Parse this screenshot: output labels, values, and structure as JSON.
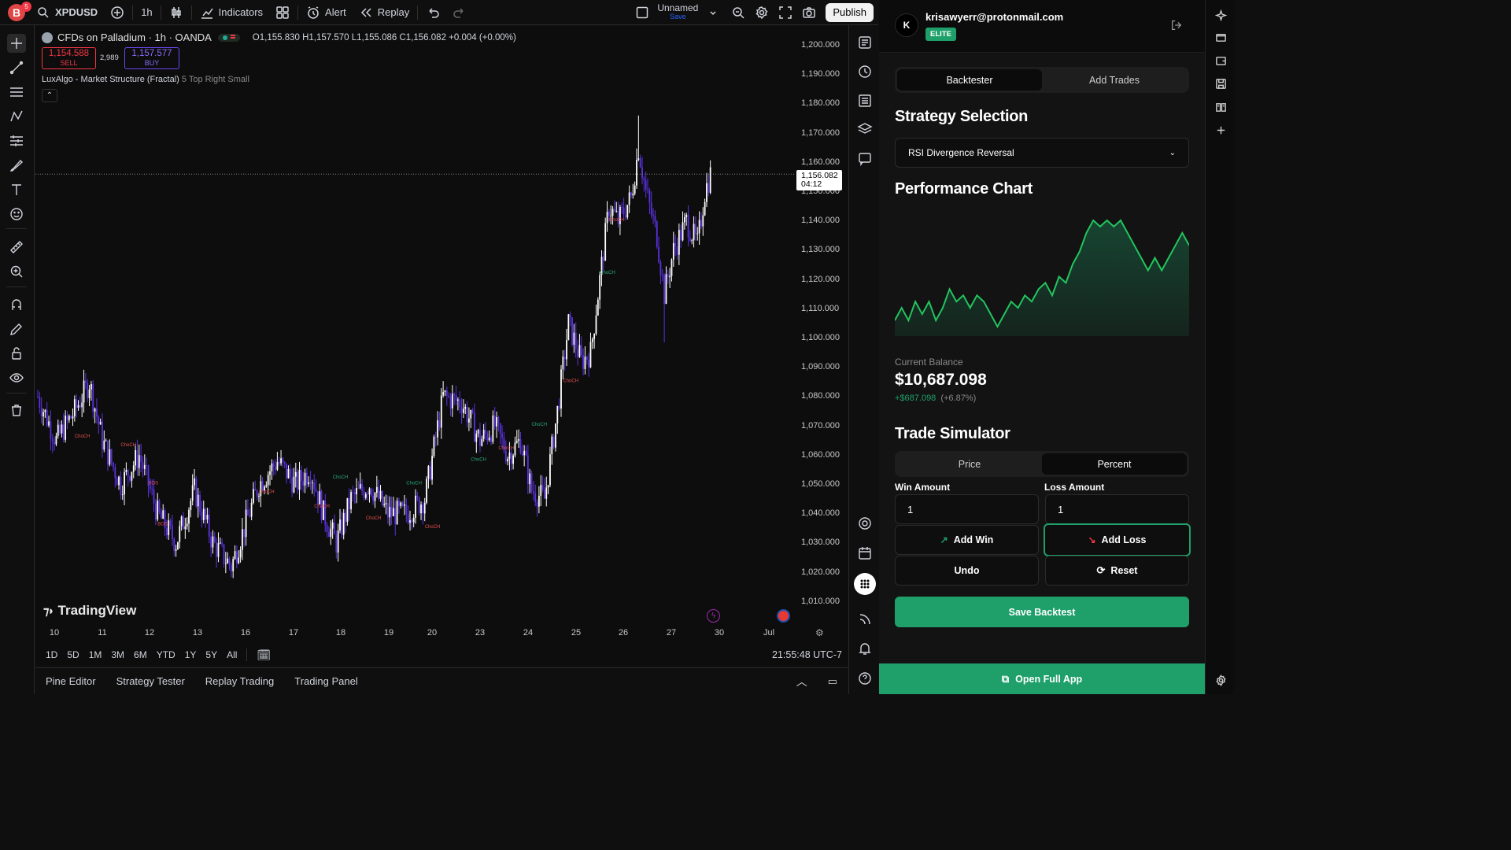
{
  "topbar": {
    "avatar_letter": "B",
    "avatar_badge": "5",
    "symbol": "XPDUSD",
    "interval": "1h",
    "indicators_label": "Indicators",
    "alert_label": "Alert",
    "replay_label": "Replay",
    "layout_name": "Unnamed",
    "layout_save": "Save",
    "publish_label": "Publish"
  },
  "legend": {
    "title": "CFDs on Palladium · 1h · OANDA",
    "ohlc": "O1,155.830 H1,157.570 L1,155.086 C1,156.082 +0.004 (+0.00%)",
    "sell_price": "1,154.588",
    "sell_label": "SELL",
    "spread": "2,989",
    "buy_price": "1,157.577",
    "buy_label": "BUY",
    "indicator_name": "LuxAlgo - Market Structure (Fractal)",
    "indicator_params": "5 Top Right Small",
    "collapse_glyph": "⌃"
  },
  "price_axis": {
    "ticks": [
      "1,200.000",
      "1,190.000",
      "1,180.000",
      "1,170.000",
      "1,160.000",
      "1,150.000",
      "1,140.000",
      "1,130.000",
      "1,120.000",
      "1,110.000",
      "1,100.000",
      "1,090.000",
      "1,080.000",
      "1,070.000",
      "1,060.000",
      "1,050.000",
      "1,040.000",
      "1,030.000",
      "1,020.000",
      "1,010.000"
    ],
    "last_price": "1,156.082",
    "countdown": "04:12"
  },
  "time_axis": {
    "ticks": [
      "10",
      "11",
      "12",
      "13",
      "16",
      "17",
      "18",
      "19",
      "20",
      "23",
      "24",
      "25",
      "26",
      "27",
      "30",
      "Jul"
    ]
  },
  "chart_data": {
    "type": "candlestick",
    "symbol": "XPDUSD",
    "ylim": [
      1010,
      1200
    ],
    "current_price": 1156.082,
    "structure_labels": [
      {
        "text": "ChoCH",
        "color": "red"
      },
      {
        "text": "BOS",
        "color": "red"
      },
      {
        "text": "ChoCH",
        "color": "green"
      },
      {
        "text": "BOS",
        "color": "green"
      }
    ]
  },
  "watermark": "TradingView",
  "range_buttons": [
    "1D",
    "5D",
    "1M",
    "3M",
    "6M",
    "YTD",
    "1Y",
    "5Y",
    "All"
  ],
  "clock": "21:55:48 UTC-7",
  "bottom_tabs": [
    "Pine Editor",
    "Strategy Tester",
    "Replay Trading",
    "Trading Panel"
  ],
  "panel": {
    "user_initial": "K",
    "email": "krisawyerr@protonmail.com",
    "tier": "ELITE",
    "tabs": [
      "Backtester",
      "Add Trades"
    ],
    "strategy_heading": "Strategy Selection",
    "strategy_value": "RSI Divergence Reversal",
    "performance_heading": "Performance Chart",
    "performance_series": [
      1,
      3,
      1,
      4,
      2,
      4,
      1,
      3,
      6,
      4,
      5,
      3,
      5,
      4,
      2,
      0,
      2,
      4,
      3,
      5,
      4,
      6,
      7,
      5,
      8,
      7,
      10,
      12,
      15,
      17,
      16,
      17,
      16,
      17,
      15,
      13,
      11,
      9,
      11,
      9,
      11,
      13,
      15,
      13
    ],
    "balance_label": "Current Balance",
    "balance": "$10,687.098",
    "change": "+$687.098",
    "change_pct": "(+6.87%)",
    "sim_heading": "Trade Simulator",
    "sim_tabs": [
      "Price",
      "Percent"
    ],
    "win_label": "Win Amount",
    "win_value": "1",
    "loss_label": "Loss Amount",
    "loss_value": "1",
    "add_win": "Add Win",
    "add_loss": "Add Loss",
    "undo": "Undo",
    "reset": "Reset",
    "save": "Save Backtest",
    "open_app": "Open Full App"
  },
  "colors": {
    "accent_green": "#1fa06a",
    "candle_up": "#ffffff",
    "candle_down": "#5b32e0",
    "sell_red": "#f23645",
    "buy_blue": "#6a48f0"
  }
}
